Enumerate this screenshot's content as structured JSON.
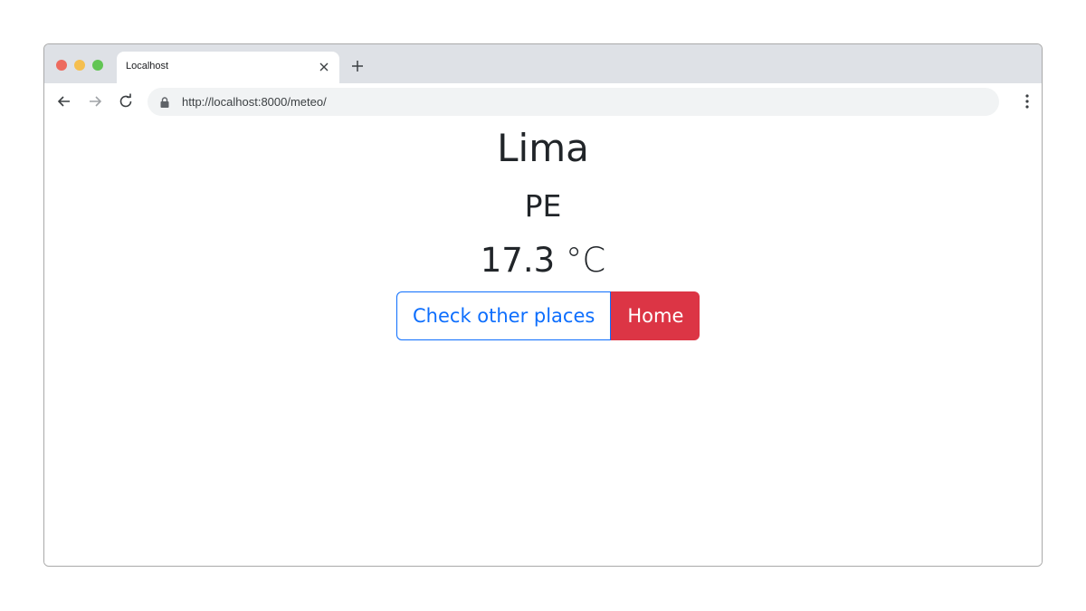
{
  "browser": {
    "tab": {
      "title": "Localhost",
      "close_icon": "close-icon"
    },
    "new_tab_icon": "plus-icon",
    "nav": {
      "back_icon": "arrow-left-icon",
      "forward_icon": "arrow-right-icon",
      "reload_icon": "reload-icon",
      "menu_icon": "kebab-menu-icon"
    },
    "address_bar": {
      "url": "http://localhost:8000/meteo/",
      "lock_icon": "lock-icon"
    }
  },
  "page": {
    "city": "Lima",
    "country": "PE",
    "temperature_value": "17.3",
    "temperature_unit": "°C",
    "buttons": {
      "check_other_places": "Check other places",
      "home": "Home"
    }
  },
  "colors": {
    "primary": "#0d6efd",
    "danger": "#dc3545",
    "text": "#212529",
    "chrome_tabbar": "#dee1e6",
    "omnibox": "#f1f3f4"
  }
}
